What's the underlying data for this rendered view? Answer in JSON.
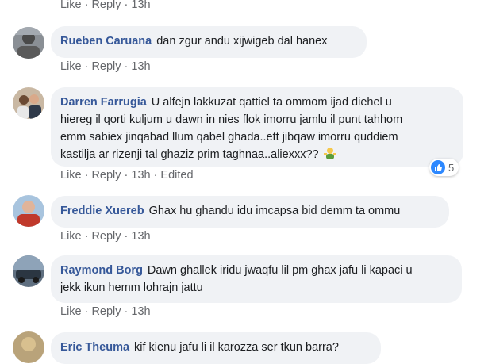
{
  "actions": {
    "like": "Like",
    "reply": "Reply",
    "sep": "·"
  },
  "top_actions": {
    "time": "13h"
  },
  "comments": [
    {
      "author": "Rueben Caruana",
      "text": "dan zgur andu xijwigeb dal hanex",
      "time": "13h",
      "edited": ""
    },
    {
      "author": "Darren Farrugia",
      "line1": "U alfejn lakkuzat qattiel ta ommom ijad diehel u",
      "line2": "hiereg il qorti kuljum u dawn in nies flok imorru jamlu il punt tahhom",
      "line3": "emm sabiex jinqabad llum qabel ghada..ett jibqaw imorru quddiem",
      "line4": "kastilja ar rizenji tal ghaziz prim taghnaa..aliexxx??",
      "emoji": "man-shrugging-emoji",
      "time": "13h",
      "edited": "Edited",
      "reaction_count": "5",
      "reaction_color": "#2d88ff"
    },
    {
      "author": "Freddie Xuereb",
      "text": "Ghax hu ghandu idu imcapsa bid demm ta ommu",
      "time": "13h"
    },
    {
      "author": "Raymond Borg",
      "line1": "Dawn ghallek iridu jwaqfu lil pm ghax jafu li kapaci u",
      "line2": "jekk ikun hemm lohrajn jattu",
      "time": "13h"
    },
    {
      "author": "Eric Theuma",
      "text": "kif kienu jafu li il karozza ser tkun barra?"
    }
  ],
  "colors": {
    "author": "#365899",
    "bubble": "#f0f2f5",
    "meta": "#65676b"
  }
}
